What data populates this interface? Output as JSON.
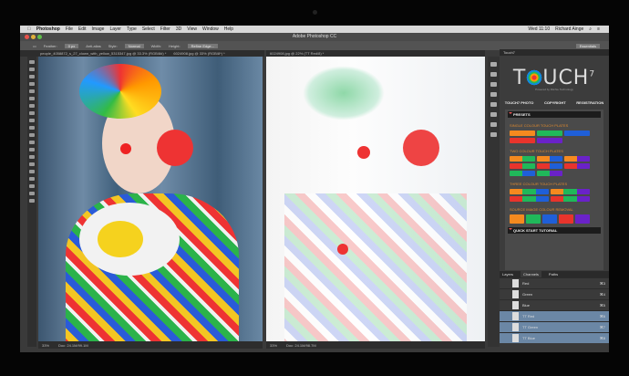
{
  "menubar": {
    "apple": "",
    "items": [
      "Photoshop",
      "File",
      "Edit",
      "Image",
      "Layer",
      "Type",
      "Select",
      "Filter",
      "3D",
      "View",
      "Window",
      "Help"
    ],
    "clock": "Wed 11:10",
    "user": "Richard Ainge"
  },
  "titlebar": {
    "title": "Adobe Photoshop CC",
    "workspace": "Essentials"
  },
  "options": {
    "feather_label": "Feather:",
    "feather_value": "0 px",
    "antialias": "Anti-alias",
    "style_label": "Style:",
    "style_value": "Normal",
    "width_label": "Width:",
    "height_label": "Height:",
    "refine": "Refine Edge..."
  },
  "tabs": {
    "left": "people_4058872_s_27_clown_with_yellow_5315347.jpg @ 33.3% (RGB/8#) *",
    "left2": "6024908.jpg @ 33% (RGB/8*) *",
    "right": "6024908.jpg @ 22% (TT Red/8) *"
  },
  "status": {
    "left_zoom": "33%",
    "left_doc": "Doc: 24.1M/99.1M",
    "right_zoom": "33%",
    "right_doc": "Doc: 24.1M/98.7M"
  },
  "touch": {
    "panel_tab": "Touch7",
    "logo": "TOUCH",
    "logo_sup": "7",
    "powered": "Powered by Ritchie Technology",
    "tabs": [
      "TOUCH7 PHOTO",
      "COPYRIGHT",
      "REGISTRATION"
    ],
    "presets": "PRESETS",
    "single": "SINGLE COLOUR TOUCH PLATES",
    "two": "TWO COLOUR TOUCH PLATES",
    "three": "THREE COLOUR TOUCH PLATES",
    "source": "SOURCE IMAGE COLOUR REMOVAL",
    "tutorial": "QUICK START TUTORIAL"
  },
  "colors": {
    "orange": "#f58a1f",
    "green": "#20b85a",
    "blue": "#1f5fd8",
    "red": "#e8342c",
    "purple": "#6a22c8"
  },
  "channels": {
    "tabs": [
      "Layers",
      "Channels",
      "Paths"
    ],
    "rows": [
      {
        "name": "Red",
        "key": "⌘3"
      },
      {
        "name": "Green",
        "key": "⌘4"
      },
      {
        "name": "Blue",
        "key": "⌘5"
      },
      {
        "name": "TT Red",
        "key": "⌘6"
      },
      {
        "name": "TT Green",
        "key": "⌘7"
      },
      {
        "name": "TT Blue",
        "key": "⌘8"
      }
    ]
  }
}
